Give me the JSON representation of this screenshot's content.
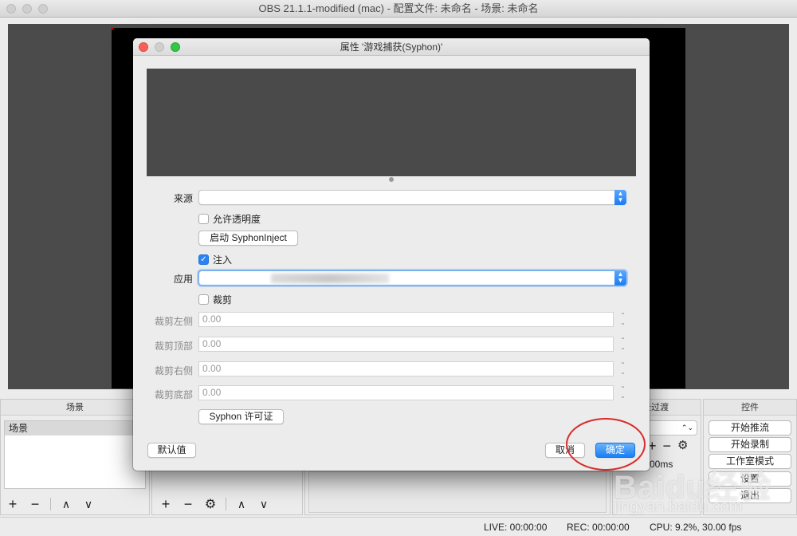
{
  "window": {
    "title": "OBS 21.1.1-modified (mac) - 配置文件: 未命名 - 场景: 未命名"
  },
  "docks": {
    "scenes": {
      "title": "场景",
      "items": [
        "场景"
      ]
    },
    "transitions": {
      "title": "景过渡",
      "duration_fragment": "00ms"
    },
    "controls": {
      "title": "控件",
      "buttons": [
        "开始推流",
        "开始录制",
        "工作室模式",
        "设置",
        "退出"
      ]
    }
  },
  "statusbar": {
    "live": "LIVE: 00:00:00",
    "rec": "REC: 00:00:00",
    "cpu": "CPU: 9.2%, 30.00 fps"
  },
  "dialog": {
    "title": "属性 '游戏捕获(Syphon)'",
    "source": {
      "label": "来源",
      "value": ""
    },
    "allow_transparency": {
      "label": "允许透明度",
      "checked": false
    },
    "launch_button": "启动 SyphonInject",
    "inject": {
      "label": "注入",
      "checked": true
    },
    "app": {
      "label": "应用",
      "value": "(blurred)"
    },
    "crop": {
      "label": "裁剪",
      "checked": false
    },
    "crop_fields": [
      {
        "label": "裁剪左侧",
        "value": "0.00"
      },
      {
        "label": "裁剪顶部",
        "value": "0.00"
      },
      {
        "label": "裁剪右侧",
        "value": "0.00"
      },
      {
        "label": "裁剪底部",
        "value": "0.00"
      }
    ],
    "license_button": "Syphon 许可证",
    "defaults_button": "默认值",
    "cancel_button": "取消",
    "ok_button": "确定"
  },
  "watermark": {
    "logo": "Baidu经验",
    "url": "jingyan.baidu.com"
  },
  "colors": {
    "accent": "#1a7ff3",
    "annotation": "#d92b2b"
  }
}
